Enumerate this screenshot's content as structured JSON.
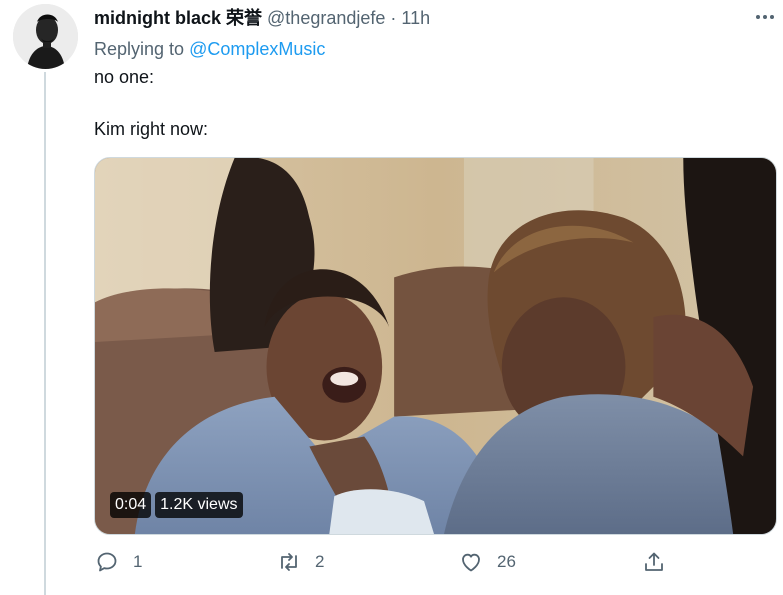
{
  "tweet": {
    "display_name": "midnight black 荣誉",
    "handle": "@thegrandjefe",
    "separator": "·",
    "time": "11h",
    "replying_prefix": "Replying to",
    "replying_to": "@ComplexMusic",
    "line1": "no one:",
    "line2": "Kim right now:"
  },
  "video": {
    "duration": "0:04",
    "views": "1.2K views"
  },
  "actions": {
    "reply_count": "1",
    "retweet_count": "2",
    "like_count": "26"
  },
  "icons": {
    "more": "more-horizontal-icon",
    "reply": "reply-icon",
    "retweet": "retweet-icon",
    "like": "heart-icon",
    "share": "share-icon"
  },
  "colors": {
    "link": "#1d9bf0",
    "secondary_text": "#536471",
    "primary_text": "#0f1419"
  }
}
